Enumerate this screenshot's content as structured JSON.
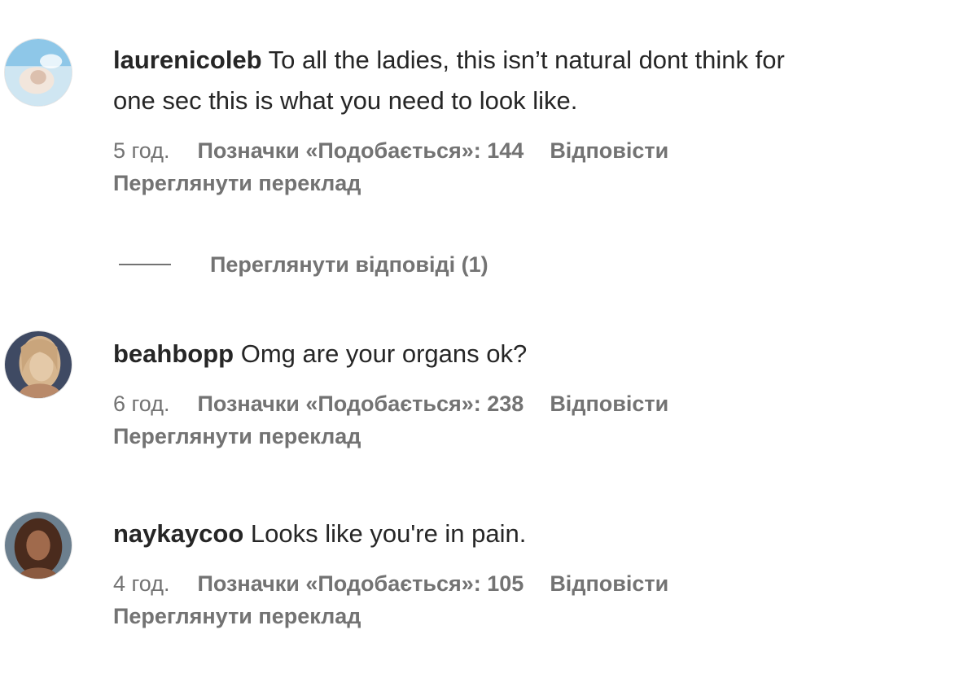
{
  "comments": [
    {
      "username": "laurenicoleb",
      "text_line1": " To all the ladies, this isn’t natural dont think for",
      "text_line2": "one sec this is what you need to look like.",
      "time": "5 год.",
      "likes": "Позначки «Подобається»: 144",
      "reply": "Відповісти",
      "translate": "Переглянути переклад",
      "avatar_colors": [
        "#8ec7e8",
        "#f2e6dc",
        "#dcc0ae"
      ]
    },
    {
      "username": "beahbopp",
      "text": " Omg are your organs ok?",
      "time": "6 год.",
      "likes": "Позначки «Подобається»: 238",
      "reply": "Відповісти",
      "translate": "Переглянути переклад",
      "avatar_colors": [
        "#3f4a63",
        "#e4c9a8",
        "#b98a6a"
      ]
    },
    {
      "username": "naykaycoo",
      "text": " Looks like you're in pain.",
      "time": "4 год.",
      "likes": "Позначки «Подобається»: 105",
      "reply": "Відповісти",
      "translate": "Переглянути переклад",
      "avatar_colors": [
        "#6c7f8e",
        "#a06a4c",
        "#4a2b1d"
      ]
    }
  ],
  "view_replies": "Переглянути відповіді (1)",
  "colors": {
    "primary_text": "#262626",
    "secondary_text": "#737373",
    "background": "#ffffff"
  }
}
